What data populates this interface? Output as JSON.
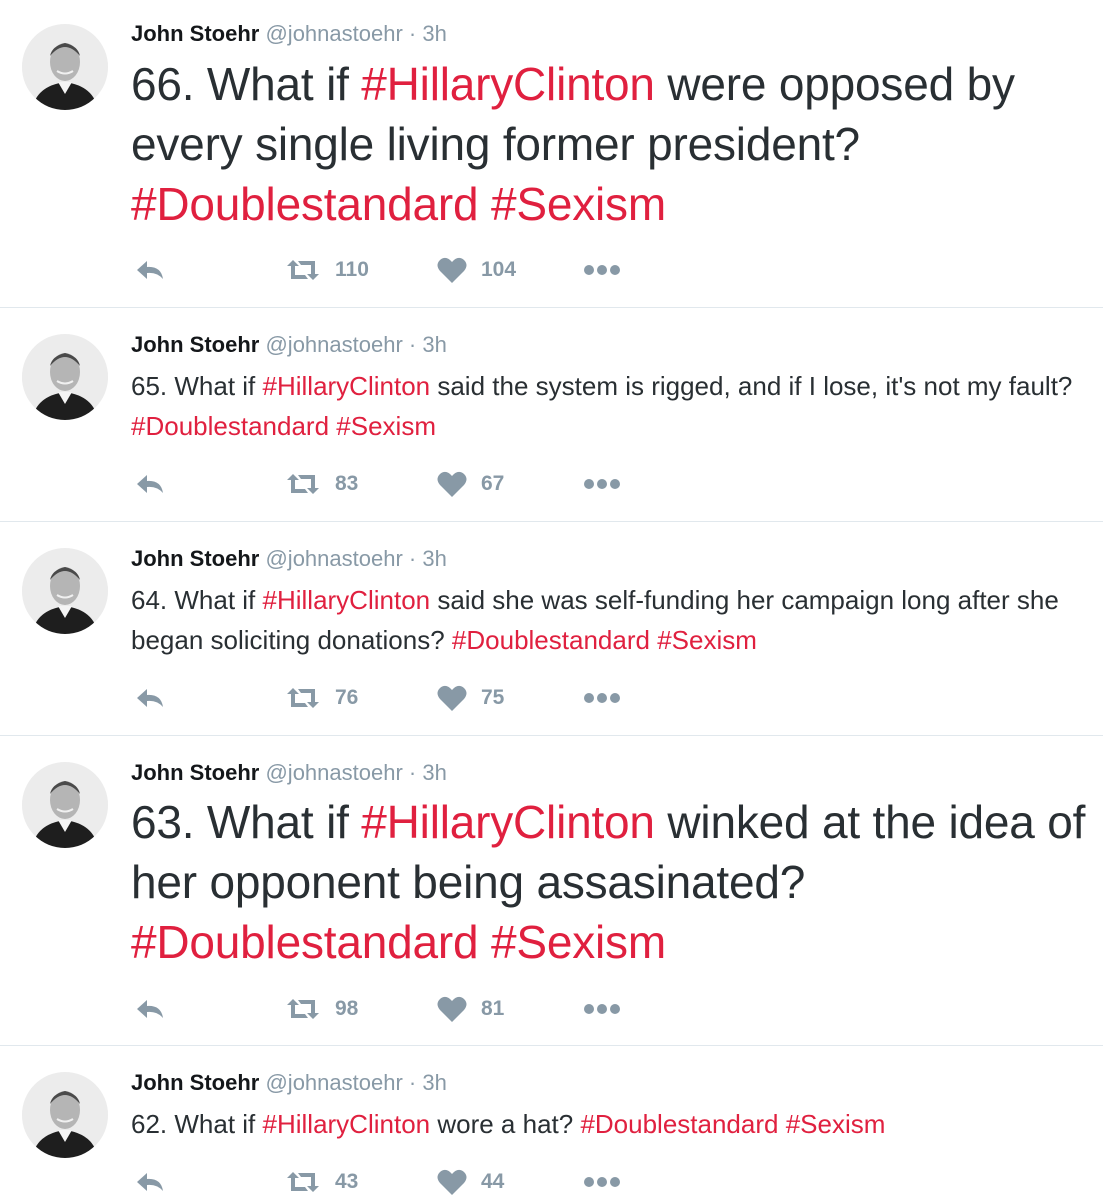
{
  "tweets": [
    {
      "name": "John Stoehr",
      "handle": "@johnastoehr",
      "separator": "·",
      "time": "3h",
      "text_parts": [
        "66. What if ",
        "#HillaryClinton",
        " were opposed by every single living former president? ",
        "#Doublestandard",
        " ",
        "#Sexism"
      ],
      "retweets": "110",
      "likes": "104"
    },
    {
      "name": "John Stoehr",
      "handle": "@johnastoehr",
      "separator": "·",
      "time": "3h",
      "text_parts": [
        "65. What if ",
        "#HillaryClinton",
        " said the system is rigged, and if I lose, it's not my fault? ",
        "#Doublestandard",
        " ",
        "#Sexism"
      ],
      "retweets": "83",
      "likes": "67"
    },
    {
      "name": "John Stoehr",
      "handle": "@johnastoehr",
      "separator": "·",
      "time": "3h",
      "text_parts": [
        "64. What if ",
        "#HillaryClinton",
        " said she was self-funding her campaign long after she began soliciting donations? ",
        "#Doublestandard",
        " ",
        "#Sexism"
      ],
      "retweets": "76",
      "likes": "75"
    },
    {
      "name": "John Stoehr",
      "handle": "@johnastoehr",
      "separator": "·",
      "time": "3h",
      "text_parts": [
        "63. What if ",
        "#HillaryClinton",
        " winked at the idea of her opponent being assasinated? ",
        "#Doublestandard",
        " ",
        "#Sexism"
      ],
      "retweets": "98",
      "likes": "81"
    },
    {
      "name": "John Stoehr",
      "handle": "@johnastoehr",
      "separator": "·",
      "time": "3h",
      "text_parts": [
        "62. What if ",
        "#HillaryClinton",
        " wore a hat? ",
        "#Doublestandard",
        " ",
        "#Sexism"
      ],
      "retweets": "43",
      "likes": "44"
    }
  ],
  "icons": {
    "reply": "reply-icon",
    "retweet": "retweet-icon",
    "like": "heart-icon",
    "more": "more-icon"
  },
  "colors": {
    "hashtag": "#e0203f",
    "meta": "#8899a6",
    "text": "#292f33",
    "divider": "#e1e8ed"
  }
}
